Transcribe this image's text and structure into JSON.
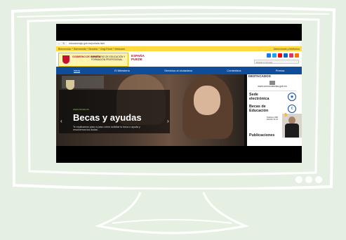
{
  "colors": {
    "background": "#e5f0e2",
    "topbar": "#ffd93d",
    "nav": "#0f4c9a",
    "accent": "#c8102e"
  },
  "browser": {
    "url": "educacionyfp.gob.es/portada.html"
  },
  "topbar": {
    "left": "Bienvenido: * Bienvenido * Benvido * Ongi Etorri * Welcome",
    "right": "Direcciones y teléfonos"
  },
  "header": {
    "gov_title": "GOBIERNO DE ESPAÑA",
    "ministry": "MINISTERIO DE EDUCACIÓN Y FORMACIÓN PROFESIONAL",
    "digital_line1": "ESPAÑA",
    "digital_line2": "PUEDE",
    "search_placeholder": "Buscar en la web"
  },
  "nav": {
    "items": [
      "Inicio",
      "El Ministerio",
      "Servicios al ciudadano",
      "Contenidos",
      "Prensa"
    ]
  },
  "hero": {
    "kicker": "www.becas.es",
    "title": "Becas y ayudas",
    "description": "Te explicamos paso a paso cómo solicitar tu beca o ayuda y resolvemos tus dudas.",
    "prev": "‹",
    "next": "›"
  },
  "sidebar": {
    "heading": "DESTACADOS",
    "site": "www.convocatorias.gob.es",
    "sede": "Sede electrónica",
    "becas": "Becas de Educación",
    "phone_label": "Teléfono 060",
    "phone": "910 83 79 37",
    "publicaciones": "Publicaciones"
  },
  "icons": [
    "shield-icon",
    "search-icon",
    "chevron-left-icon",
    "chevron-right-icon",
    "hand-icon"
  ]
}
